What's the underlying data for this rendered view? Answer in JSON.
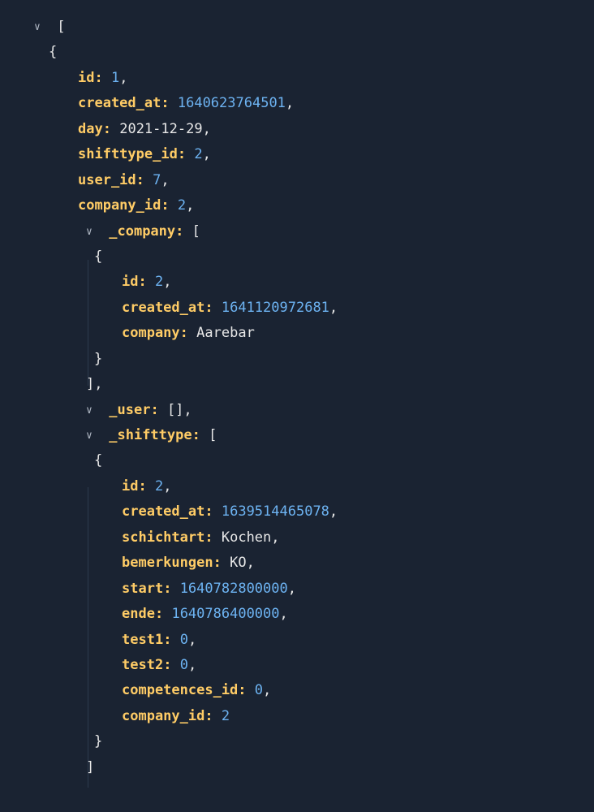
{
  "root": {
    "open_bracket": "[",
    "open_brace": "{",
    "fields": {
      "id": {
        "key": "id",
        "value": "1"
      },
      "created_at": {
        "key": "created_at",
        "value": "1640623764501"
      },
      "day": {
        "key": "day",
        "value": "2021-12-29"
      },
      "shifttype_id": {
        "key": "shifttype_id",
        "value": "2"
      },
      "user_id": {
        "key": "user_id",
        "value": "7"
      },
      "company_id": {
        "key": "company_id",
        "value": "2"
      }
    },
    "company": {
      "key": "_company",
      "open": "[",
      "brace_open": "{",
      "fields": {
        "id": {
          "key": "id",
          "value": "2"
        },
        "created_at": {
          "key": "created_at",
          "value": "1641120972681"
        },
        "company": {
          "key": "company",
          "value": "Aarebar"
        }
      },
      "brace_close": "}",
      "close": "],"
    },
    "user": {
      "key": "_user",
      "value": "[],"
    },
    "shifttype": {
      "key": "_shifttype",
      "open": "[",
      "brace_open": "{",
      "fields": {
        "id": {
          "key": "id",
          "value": "2"
        },
        "created_at": {
          "key": "created_at",
          "value": "1639514465078"
        },
        "schichtart": {
          "key": "schichtart",
          "value": "Kochen"
        },
        "bemerkungen": {
          "key": "bemerkungen",
          "value": "KO"
        },
        "start": {
          "key": "start",
          "value": "1640782800000"
        },
        "ende": {
          "key": "ende",
          "value": "1640786400000"
        },
        "test1": {
          "key": "test1",
          "value": "0"
        },
        "test2": {
          "key": "test2",
          "value": "0"
        },
        "competences_id": {
          "key": "competences_id",
          "value": "0"
        },
        "company_id": {
          "key": "company_id",
          "value": "2"
        }
      },
      "brace_close": "}",
      "close": "]"
    }
  },
  "punct": {
    "colon": ":",
    "comma": ",",
    "chevron": "∨"
  }
}
